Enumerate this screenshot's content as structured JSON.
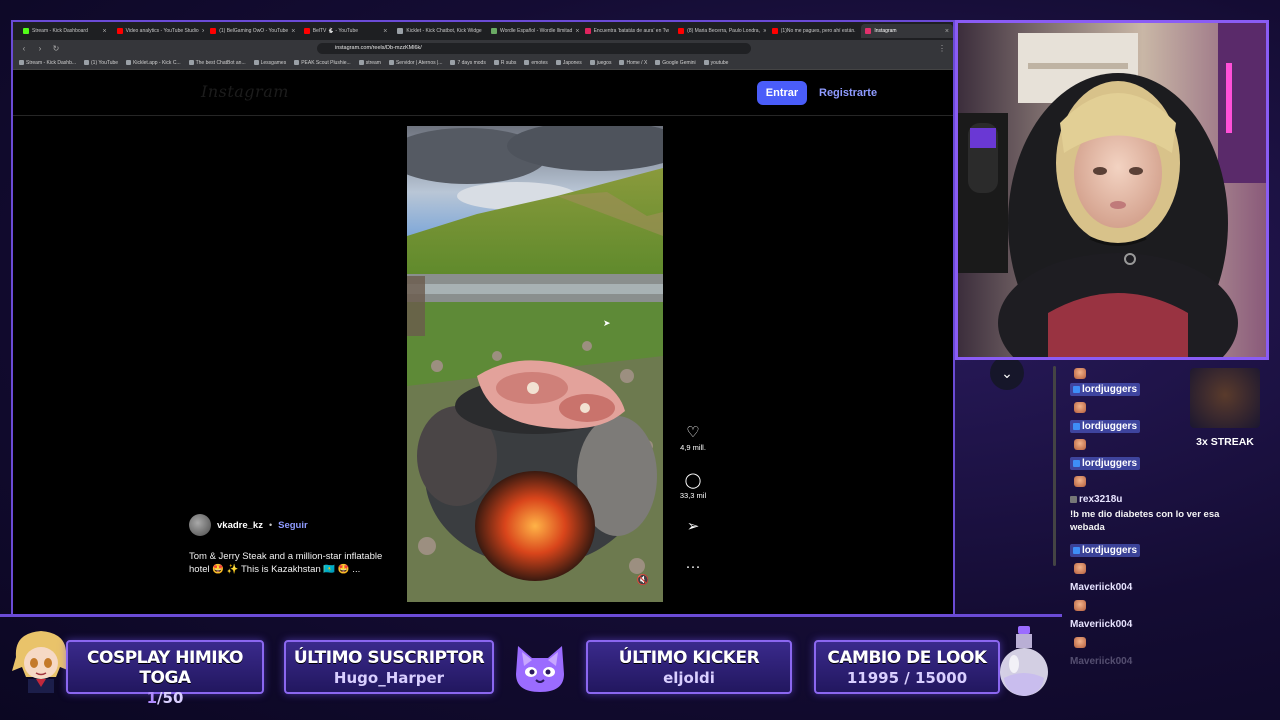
{
  "browser": {
    "tabs": [
      {
        "label": "Stream - Kick Dashboard",
        "color": "#53fc18"
      },
      {
        "label": "Video analytics - YouTube Studio",
        "color": "#ff0000"
      },
      {
        "label": "(1) BelGaming OwO - YouTube",
        "color": "#ff0000"
      },
      {
        "label": "BelTV 🐇 - YouTube",
        "color": "#ff0000"
      },
      {
        "label": "Kicklet - Kick Chatbot, Kick Widge",
        "color": "#9aa0a6"
      },
      {
        "label": "Wordle Español - Wordle llimitad",
        "color": "#6aaa64"
      },
      {
        "label": "Encuentra 'batatás de aura' en Tw",
        "color": "#e0245e"
      },
      {
        "label": "(8) Maria Becerra, Paulo Londra, ",
        "color": "#ff0000"
      },
      {
        "label": "(1)No me pagues, pero ahí están. ",
        "color": "#ff0000"
      },
      {
        "label": "Instagram",
        "color": "#e1306c",
        "active": true
      }
    ],
    "url": "instagram.com/reels/Db-mzzKMl6k/",
    "bookmarks": [
      "Stream - Kick Dashb...",
      "(1) YouTube",
      "Kicklet.app - Kick C...",
      "The best ChatBot an...",
      "Lessgames",
      "PEAK Scout Plushie...",
      "stream",
      "Servidor | Aternos |...",
      "7 days mods",
      "R subs",
      "emotes",
      "Japones",
      "juegos",
      "Home / X",
      "Google Gemini",
      "youtube"
    ]
  },
  "instagram": {
    "logo": "Instagram",
    "login_label": "Entrar",
    "signup_label": "Registrarte",
    "likes": "4,9 mill.",
    "comments": "33,3 mil",
    "author": "vkadre_kz",
    "follow_label": "Seguir",
    "caption": "Tom & Jerry Steak and a million-star inflatable hotel 🤩 ✨ This is Kazakhstan 🇰🇿 🤩 ..."
  },
  "chat": {
    "streak_label": "3x STREAK",
    "messages": [
      {
        "user": "lordjuggers",
        "text": ""
      },
      {
        "user": "lordjuggers",
        "text": ""
      },
      {
        "user": "lordjuggers",
        "text": ""
      },
      {
        "user": "rex3218u",
        "text": "!b me dio diabetes con lo ver esa webada"
      },
      {
        "user": "lordjuggers",
        "text": ""
      },
      {
        "user": "Maveriick004",
        "text": ""
      },
      {
        "user": "Maveriick004",
        "text": ""
      },
      {
        "user": "Maveriick004",
        "text": ""
      }
    ]
  },
  "overlay": {
    "panels": [
      {
        "title": "COSPLAY HIMIKO TOGA",
        "value_prefix": "1",
        "value_suffix": "/50"
      },
      {
        "title": "ÚLTIMO SUSCRIPTOR",
        "value": "Hugo_Harper"
      },
      {
        "title": "ÚLTIMO KICKER",
        "value": "eljoldi"
      },
      {
        "title": "CAMBIO DE LOOK",
        "value": "11995 / 15000"
      }
    ],
    "accent_color": "#8b67f0"
  }
}
